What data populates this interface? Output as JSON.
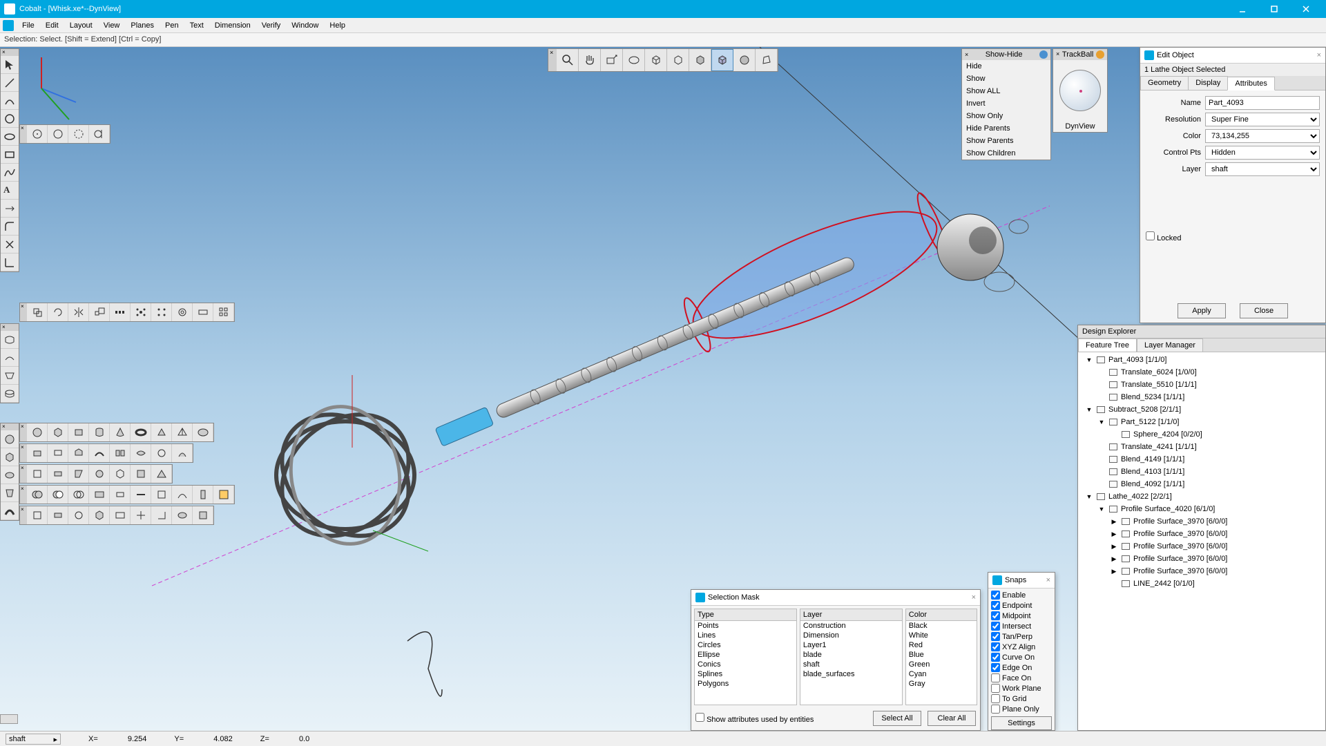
{
  "app": {
    "title": "Cobalt - [Whisk.xe*--DynView]"
  },
  "menu": [
    "File",
    "Edit",
    "Layout",
    "View",
    "Planes",
    "Pen",
    "Text",
    "Dimension",
    "Verify",
    "Window",
    "Help"
  ],
  "hint": "Selection: Select. [Shift = Extend] [Ctrl = Copy]",
  "showhide": {
    "title": "Show-Hide",
    "items": [
      "Hide",
      "Show",
      "Show ALL",
      "Invert",
      "Show Only",
      "Hide Parents",
      "Show Parents",
      "Show Children"
    ]
  },
  "trackball": {
    "title": "TrackBall",
    "view": "DynView"
  },
  "edit_object": {
    "title": "Edit Object",
    "sub": "1 Lathe Object Selected",
    "tabs": [
      "Geometry",
      "Display",
      "Attributes"
    ],
    "active_tab": "Attributes",
    "fields": {
      "name_label": "Name",
      "name": "Part_4093",
      "resolution_label": "Resolution",
      "resolution": "Super Fine",
      "color_label": "Color",
      "color": "73,134,255",
      "controlpts_label": "Control Pts",
      "controlpts": "Hidden",
      "layer_label": "Layer",
      "layer": "shaft",
      "locked_label": "Locked"
    },
    "apply": "Apply",
    "close": "Close"
  },
  "explorer": {
    "title": "Design Explorer",
    "tabs": [
      "Feature Tree",
      "Layer Manager"
    ],
    "tree": [
      {
        "d": 0,
        "t": "▼",
        "label": "Part_4093 [1/1/0]"
      },
      {
        "d": 1,
        "t": "",
        "label": "Translate_6024 [1/0/0]"
      },
      {
        "d": 1,
        "t": "",
        "label": "Translate_5510 [1/1/1]"
      },
      {
        "d": 1,
        "t": "",
        "label": "Blend_5234 [1/1/1]"
      },
      {
        "d": 0,
        "t": "▼",
        "label": "Subtract_5208 [2/1/1]"
      },
      {
        "d": 1,
        "t": "▼",
        "label": "Part_5122 [1/1/0]"
      },
      {
        "d": 2,
        "t": "",
        "label": "Sphere_4204 [0/2/0]"
      },
      {
        "d": 1,
        "t": "",
        "label": "Translate_4241 [1/1/1]"
      },
      {
        "d": 1,
        "t": "",
        "label": "Blend_4149 [1/1/1]"
      },
      {
        "d": 1,
        "t": "",
        "label": "Blend_4103 [1/1/1]"
      },
      {
        "d": 1,
        "t": "",
        "label": "Blend_4092 [1/1/1]"
      },
      {
        "d": 0,
        "t": "▼",
        "label": "Lathe_4022 [2/2/1]"
      },
      {
        "d": 1,
        "t": "▼",
        "label": "Profile Surface_4020 [6/1/0]"
      },
      {
        "d": 2,
        "t": "▶",
        "label": "Profile Surface_3970 [6/0/0]"
      },
      {
        "d": 2,
        "t": "▶",
        "label": "Profile Surface_3970 [6/0/0]"
      },
      {
        "d": 2,
        "t": "▶",
        "label": "Profile Surface_3970 [6/0/0]"
      },
      {
        "d": 2,
        "t": "▶",
        "label": "Profile Surface_3970 [6/0/0]"
      },
      {
        "d": 2,
        "t": "▶",
        "label": "Profile Surface_3970 [6/0/0]"
      },
      {
        "d": 2,
        "t": "",
        "label": "LINE_2442 [0/1/0]"
      }
    ]
  },
  "selmask": {
    "title": "Selection Mask",
    "type_hdr": "Type",
    "types": [
      "Points",
      "Lines",
      "Circles",
      "Ellipse",
      "Conics",
      "Splines",
      "Polygons"
    ],
    "layer_hdr": "Layer",
    "layers": [
      "Construction",
      "Dimension",
      "Layer1",
      "blade",
      "shaft",
      "blade_surfaces"
    ],
    "color_hdr": "Color",
    "colors": [
      "Black",
      "White",
      "Red",
      "Blue",
      "Green",
      "Cyan",
      "Gray"
    ],
    "show_attrs": "Show attributes used by entities",
    "select_all": "Select All",
    "clear_all": "Clear All"
  },
  "snaps": {
    "title": "Snaps",
    "items": [
      {
        "label": "Enable",
        "on": true
      },
      {
        "label": "Endpoint",
        "on": true
      },
      {
        "label": "Midpoint",
        "on": true
      },
      {
        "label": "Intersect",
        "on": true
      },
      {
        "label": "Tan/Perp",
        "on": true
      },
      {
        "label": "XYZ Align",
        "on": true
      },
      {
        "label": "Curve On",
        "on": true
      },
      {
        "label": "Edge On",
        "on": true
      },
      {
        "label": "Face On",
        "on": false
      },
      {
        "label": "Work Plane",
        "on": false
      },
      {
        "label": "To Grid",
        "on": false
      },
      {
        "label": "Plane Only",
        "on": false
      }
    ],
    "settings": "Settings"
  },
  "status": {
    "layer": "shaft",
    "x_label": "X=",
    "x": "9.254",
    "y_label": "Y=",
    "y": "4.082",
    "z_label": "Z=",
    "z": "0.0"
  }
}
